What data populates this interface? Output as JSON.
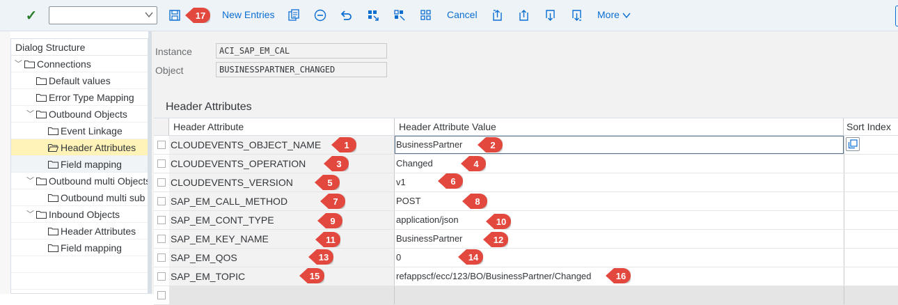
{
  "toolbar": {
    "command_value": "",
    "new_entries": "New Entries",
    "cancel": "Cancel",
    "more": "More"
  },
  "dialog": {
    "title": "Dialog Structure",
    "items": [
      {
        "label": "Connections"
      },
      {
        "label": "Default values"
      },
      {
        "label": "Error Type Mapping"
      },
      {
        "label": "Outbound  Objects"
      },
      {
        "label": "Event Linkage"
      },
      {
        "label": "Header Attributes"
      },
      {
        "label": "Field mapping"
      },
      {
        "label": "Outbound multi Objects"
      },
      {
        "label": "Outbound multi sub O"
      },
      {
        "label": "Inbound Objects"
      },
      {
        "label": "Header Attributes"
      },
      {
        "label": "Field mapping"
      }
    ]
  },
  "fields": {
    "instance_label": "Instance",
    "instance_value": "ACI_SAP_EM_CAL",
    "object_label": "Object",
    "object_value": "BUSINESSPARTNER_CHANGED"
  },
  "section_title": "Header Attributes",
  "table": {
    "headers": [
      "Header Attribute",
      "Header Attribute Value",
      "Sort Index"
    ],
    "rows": [
      {
        "attr": "CLOUDEVENTS_OBJECT_NAME",
        "value": "BusinessPartner",
        "a_badge": "1",
        "v_badge": "2"
      },
      {
        "attr": "CLOUDEVENTS_OPERATION",
        "value": "Changed",
        "a_badge": "3",
        "v_badge": "4"
      },
      {
        "attr": "CLOUDEVENTS_VERSION",
        "value": "v1",
        "a_badge": "5",
        "v_badge": "6"
      },
      {
        "attr": "SAP_EM_CALL_METHOD",
        "value": "POST",
        "a_badge": "7",
        "v_badge": "8"
      },
      {
        "attr": "SAP_EM_CONT_TYPE",
        "value": "application/json",
        "a_badge": "9",
        "v_badge": "10"
      },
      {
        "attr": "SAP_EM_KEY_NAME",
        "value": "BusinessPartner",
        "a_badge": "11",
        "v_badge": "12"
      },
      {
        "attr": "SAP_EM_QOS",
        "value": "0",
        "a_badge": "13",
        "v_badge": "14"
      },
      {
        "attr": "SAP_EM_TOPIC",
        "value": "refappscf/ecc/123/BO/BusinessPartner/Changed",
        "a_badge": "15",
        "v_badge": "16"
      }
    ]
  },
  "save_badge": "17",
  "colors": {
    "accent": "#0a6ed1",
    "badge": "#e2483d",
    "selected": "#fff3b8",
    "check": "#2b7d2b"
  }
}
